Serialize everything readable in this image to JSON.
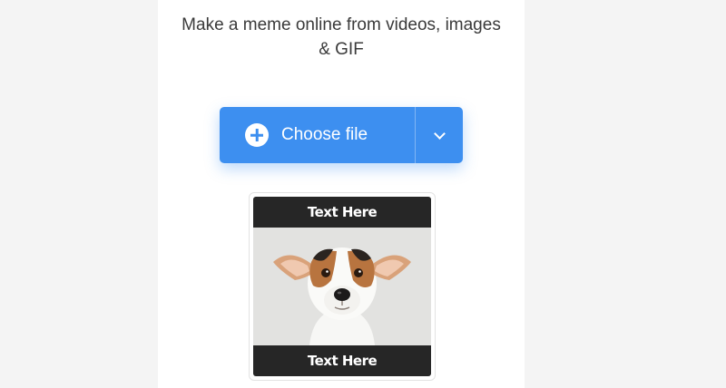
{
  "hero": {
    "subtitle_line1": "Make a meme online from videos, images",
    "subtitle_line2": "& GIF"
  },
  "upload": {
    "choose_label": "Choose file",
    "plus_icon": "plus-circle-icon",
    "dropdown_icon": "chevron-down-icon",
    "accent_color": "#3d8ff0"
  },
  "meme_preview": {
    "top_text": "Text Here",
    "bottom_text": "Text Here",
    "image_subject": "dog-photo"
  }
}
